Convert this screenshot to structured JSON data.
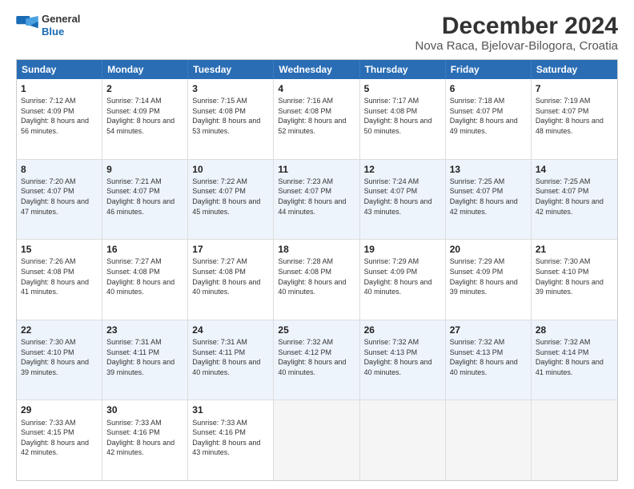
{
  "header": {
    "logo_line1": "General",
    "logo_line2": "Blue",
    "main_title": "December 2024",
    "subtitle": "Nova Raca, Bjelovar-Bilogora, Croatia"
  },
  "days_of_week": [
    "Sunday",
    "Monday",
    "Tuesday",
    "Wednesday",
    "Thursday",
    "Friday",
    "Saturday"
  ],
  "weeks": [
    {
      "alt": false,
      "cells": [
        {
          "day": "1",
          "sunrise": "Sunrise: 7:12 AM",
          "sunset": "Sunset: 4:09 PM",
          "daylight": "Daylight: 8 hours and 56 minutes."
        },
        {
          "day": "2",
          "sunrise": "Sunrise: 7:14 AM",
          "sunset": "Sunset: 4:09 PM",
          "daylight": "Daylight: 8 hours and 54 minutes."
        },
        {
          "day": "3",
          "sunrise": "Sunrise: 7:15 AM",
          "sunset": "Sunset: 4:08 PM",
          "daylight": "Daylight: 8 hours and 53 minutes."
        },
        {
          "day": "4",
          "sunrise": "Sunrise: 7:16 AM",
          "sunset": "Sunset: 4:08 PM",
          "daylight": "Daylight: 8 hours and 52 minutes."
        },
        {
          "day": "5",
          "sunrise": "Sunrise: 7:17 AM",
          "sunset": "Sunset: 4:08 PM",
          "daylight": "Daylight: 8 hours and 50 minutes."
        },
        {
          "day": "6",
          "sunrise": "Sunrise: 7:18 AM",
          "sunset": "Sunset: 4:07 PM",
          "daylight": "Daylight: 8 hours and 49 minutes."
        },
        {
          "day": "7",
          "sunrise": "Sunrise: 7:19 AM",
          "sunset": "Sunset: 4:07 PM",
          "daylight": "Daylight: 8 hours and 48 minutes."
        }
      ]
    },
    {
      "alt": true,
      "cells": [
        {
          "day": "8",
          "sunrise": "Sunrise: 7:20 AM",
          "sunset": "Sunset: 4:07 PM",
          "daylight": "Daylight: 8 hours and 47 minutes."
        },
        {
          "day": "9",
          "sunrise": "Sunrise: 7:21 AM",
          "sunset": "Sunset: 4:07 PM",
          "daylight": "Daylight: 8 hours and 46 minutes."
        },
        {
          "day": "10",
          "sunrise": "Sunrise: 7:22 AM",
          "sunset": "Sunset: 4:07 PM",
          "daylight": "Daylight: 8 hours and 45 minutes."
        },
        {
          "day": "11",
          "sunrise": "Sunrise: 7:23 AM",
          "sunset": "Sunset: 4:07 PM",
          "daylight": "Daylight: 8 hours and 44 minutes."
        },
        {
          "day": "12",
          "sunrise": "Sunrise: 7:24 AM",
          "sunset": "Sunset: 4:07 PM",
          "daylight": "Daylight: 8 hours and 43 minutes."
        },
        {
          "day": "13",
          "sunrise": "Sunrise: 7:25 AM",
          "sunset": "Sunset: 4:07 PM",
          "daylight": "Daylight: 8 hours and 42 minutes."
        },
        {
          "day": "14",
          "sunrise": "Sunrise: 7:25 AM",
          "sunset": "Sunset: 4:07 PM",
          "daylight": "Daylight: 8 hours and 42 minutes."
        }
      ]
    },
    {
      "alt": false,
      "cells": [
        {
          "day": "15",
          "sunrise": "Sunrise: 7:26 AM",
          "sunset": "Sunset: 4:08 PM",
          "daylight": "Daylight: 8 hours and 41 minutes."
        },
        {
          "day": "16",
          "sunrise": "Sunrise: 7:27 AM",
          "sunset": "Sunset: 4:08 PM",
          "daylight": "Daylight: 8 hours and 40 minutes."
        },
        {
          "day": "17",
          "sunrise": "Sunrise: 7:27 AM",
          "sunset": "Sunset: 4:08 PM",
          "daylight": "Daylight: 8 hours and 40 minutes."
        },
        {
          "day": "18",
          "sunrise": "Sunrise: 7:28 AM",
          "sunset": "Sunset: 4:08 PM",
          "daylight": "Daylight: 8 hours and 40 minutes."
        },
        {
          "day": "19",
          "sunrise": "Sunrise: 7:29 AM",
          "sunset": "Sunset: 4:09 PM",
          "daylight": "Daylight: 8 hours and 40 minutes."
        },
        {
          "day": "20",
          "sunrise": "Sunrise: 7:29 AM",
          "sunset": "Sunset: 4:09 PM",
          "daylight": "Daylight: 8 hours and 39 minutes."
        },
        {
          "day": "21",
          "sunrise": "Sunrise: 7:30 AM",
          "sunset": "Sunset: 4:10 PM",
          "daylight": "Daylight: 8 hours and 39 minutes."
        }
      ]
    },
    {
      "alt": true,
      "cells": [
        {
          "day": "22",
          "sunrise": "Sunrise: 7:30 AM",
          "sunset": "Sunset: 4:10 PM",
          "daylight": "Daylight: 8 hours and 39 minutes."
        },
        {
          "day": "23",
          "sunrise": "Sunrise: 7:31 AM",
          "sunset": "Sunset: 4:11 PM",
          "daylight": "Daylight: 8 hours and 39 minutes."
        },
        {
          "day": "24",
          "sunrise": "Sunrise: 7:31 AM",
          "sunset": "Sunset: 4:11 PM",
          "daylight": "Daylight: 8 hours and 40 minutes."
        },
        {
          "day": "25",
          "sunrise": "Sunrise: 7:32 AM",
          "sunset": "Sunset: 4:12 PM",
          "daylight": "Daylight: 8 hours and 40 minutes."
        },
        {
          "day": "26",
          "sunrise": "Sunrise: 7:32 AM",
          "sunset": "Sunset: 4:13 PM",
          "daylight": "Daylight: 8 hours and 40 minutes."
        },
        {
          "day": "27",
          "sunrise": "Sunrise: 7:32 AM",
          "sunset": "Sunset: 4:13 PM",
          "daylight": "Daylight: 8 hours and 40 minutes."
        },
        {
          "day": "28",
          "sunrise": "Sunrise: 7:32 AM",
          "sunset": "Sunset: 4:14 PM",
          "daylight": "Daylight: 8 hours and 41 minutes."
        }
      ]
    },
    {
      "alt": false,
      "cells": [
        {
          "day": "29",
          "sunrise": "Sunrise: 7:33 AM",
          "sunset": "Sunset: 4:15 PM",
          "daylight": "Daylight: 8 hours and 42 minutes."
        },
        {
          "day": "30",
          "sunrise": "Sunrise: 7:33 AM",
          "sunset": "Sunset: 4:16 PM",
          "daylight": "Daylight: 8 hours and 42 minutes."
        },
        {
          "day": "31",
          "sunrise": "Sunrise: 7:33 AM",
          "sunset": "Sunset: 4:16 PM",
          "daylight": "Daylight: 8 hours and 43 minutes."
        },
        {
          "day": "",
          "sunrise": "",
          "sunset": "",
          "daylight": ""
        },
        {
          "day": "",
          "sunrise": "",
          "sunset": "",
          "daylight": ""
        },
        {
          "day": "",
          "sunrise": "",
          "sunset": "",
          "daylight": ""
        },
        {
          "day": "",
          "sunrise": "",
          "sunset": "",
          "daylight": ""
        }
      ]
    }
  ]
}
